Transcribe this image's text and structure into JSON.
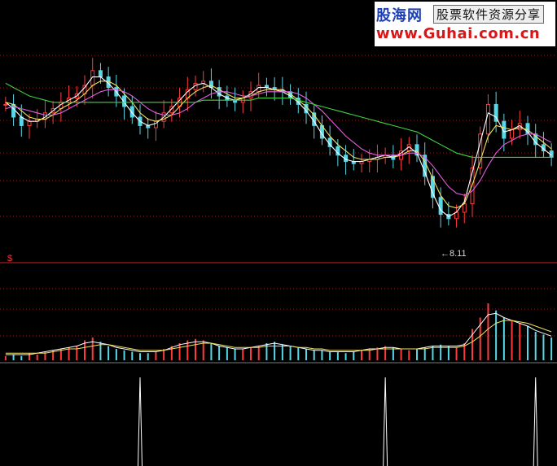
{
  "watermark": {
    "brand": "股海网",
    "tagline": "股票软件资源分享",
    "url": "www.Guhai.com.cn"
  },
  "price_label": "8.11",
  "marker": "$",
  "colors": {
    "background": "#000000",
    "up": "#ff3c3c",
    "down": "#5ad7e6",
    "ma_fast": "#ffffff",
    "ma_mid": "#f0e060",
    "ma_slow": "#e060e0",
    "ma_long": "#3fd43f",
    "grid": "#9b1a1a",
    "separator": "#d02020",
    "signal": "#ffffff"
  },
  "chart_data": [
    {
      "type": "candlestick",
      "title": "",
      "annotation": {
        "label": "8.11",
        "type": "low"
      },
      "series": [
        {
          "kind": "close",
          "values": [
            10.9,
            10.6,
            10.4,
            10.5,
            10.55,
            10.7,
            10.8,
            10.95,
            11.05,
            11.15,
            11.35,
            11.7,
            11.55,
            11.3,
            11.1,
            10.85,
            10.6,
            10.4,
            10.35,
            10.5,
            10.7,
            10.85,
            11.05,
            11.25,
            11.4,
            11.45,
            11.3,
            11.1,
            11.0,
            10.95,
            11.05,
            11.2,
            11.35,
            11.3,
            11.25,
            11.2,
            11.05,
            10.9,
            10.7,
            10.4,
            10.1,
            9.9,
            9.7,
            9.55,
            9.5,
            9.55,
            9.6,
            9.65,
            9.7,
            9.6,
            9.8,
            9.95,
            9.7,
            9.2,
            8.7,
            8.3,
            8.2,
            8.35,
            8.55,
            9.4,
            10.2,
            10.9,
            10.5,
            10.1,
            10.3,
            10.45,
            10.2,
            9.95,
            9.8,
            9.65
          ]
        },
        {
          "kind": "ma_fast",
          "values": [
            10.95,
            10.8,
            10.6,
            10.5,
            10.5,
            10.6,
            10.75,
            10.9,
            11.0,
            11.1,
            11.3,
            11.55,
            11.55,
            11.4,
            11.2,
            10.95,
            10.7,
            10.5,
            10.4,
            10.45,
            10.6,
            10.8,
            11.0,
            11.2,
            11.35,
            11.4,
            11.3,
            11.15,
            11.05,
            11.0,
            11.05,
            11.15,
            11.3,
            11.3,
            11.25,
            11.2,
            11.1,
            10.95,
            10.75,
            10.5,
            10.2,
            9.95,
            9.75,
            9.6,
            9.55,
            9.55,
            9.6,
            9.65,
            9.7,
            9.65,
            9.75,
            9.9,
            9.75,
            9.3,
            8.8,
            8.4,
            8.25,
            8.35,
            8.6,
            9.3,
            10.0,
            10.7,
            10.6,
            10.25,
            10.3,
            10.4,
            10.25,
            10.0,
            9.85,
            9.7
          ]
        },
        {
          "kind": "ma_mid",
          "values": [
            10.95,
            10.9,
            10.75,
            10.6,
            10.55,
            10.55,
            10.65,
            10.8,
            10.9,
            11.0,
            11.15,
            11.35,
            11.45,
            11.45,
            11.35,
            11.15,
            10.95,
            10.7,
            10.55,
            10.5,
            10.55,
            10.65,
            10.85,
            11.05,
            11.2,
            11.3,
            11.35,
            11.25,
            11.15,
            11.05,
            11.05,
            11.1,
            11.2,
            11.25,
            11.25,
            11.25,
            11.15,
            11.0,
            10.85,
            10.65,
            10.4,
            10.15,
            9.95,
            9.8,
            9.65,
            9.6,
            9.6,
            9.6,
            9.65,
            9.65,
            9.7,
            9.8,
            9.8,
            9.55,
            9.15,
            8.75,
            8.5,
            8.45,
            8.55,
            9.0,
            9.55,
            10.15,
            10.4,
            10.35,
            10.3,
            10.35,
            10.3,
            10.15,
            10.0,
            9.85
          ]
        },
        {
          "kind": "ma_slow",
          "values": [
            10.8,
            10.85,
            10.8,
            10.75,
            10.7,
            10.65,
            10.65,
            10.7,
            10.8,
            10.9,
            11.0,
            11.1,
            11.2,
            11.25,
            11.25,
            11.2,
            11.1,
            10.95,
            10.8,
            10.7,
            10.65,
            10.65,
            10.7,
            10.8,
            10.95,
            11.05,
            11.15,
            11.2,
            11.2,
            11.15,
            11.1,
            11.1,
            11.15,
            11.2,
            11.2,
            11.2,
            11.2,
            11.15,
            11.05,
            10.9,
            10.75,
            10.55,
            10.35,
            10.15,
            10.0,
            9.85,
            9.75,
            9.7,
            9.7,
            9.7,
            9.7,
            9.75,
            9.75,
            9.65,
            9.45,
            9.2,
            8.95,
            8.8,
            8.75,
            8.85,
            9.1,
            9.45,
            9.75,
            9.95,
            10.05,
            10.15,
            10.2,
            10.2,
            10.1,
            10.0
          ]
        },
        {
          "kind": "ma_long",
          "values": [
            11.4,
            11.3,
            11.2,
            11.1,
            11.05,
            11.0,
            10.95,
            10.95,
            10.95,
            10.95,
            10.95,
            10.95,
            10.95,
            10.95,
            10.95,
            10.95,
            10.95,
            10.95,
            10.95,
            10.95,
            10.95,
            10.95,
            10.95,
            10.95,
            10.95,
            11.0,
            11.0,
            11.0,
            11.0,
            11.0,
            11.0,
            11.0,
            11.05,
            11.05,
            11.05,
            11.05,
            11.05,
            11.0,
            10.95,
            10.9,
            10.85,
            10.8,
            10.75,
            10.7,
            10.65,
            10.6,
            10.55,
            10.5,
            10.45,
            10.4,
            10.35,
            10.3,
            10.25,
            10.15,
            10.05,
            9.95,
            9.85,
            9.75,
            9.7,
            9.65,
            9.65,
            9.65,
            9.65,
            9.65,
            9.65,
            9.65,
            9.65,
            9.65,
            9.65,
            9.65
          ]
        }
      ]
    },
    {
      "type": "bar",
      "title": "",
      "values": [
        3,
        4,
        3,
        5,
        4,
        6,
        7,
        8,
        9,
        10,
        14,
        16,
        13,
        10,
        8,
        7,
        6,
        5,
        5,
        6,
        8,
        10,
        12,
        14,
        15,
        14,
        12,
        10,
        9,
        8,
        8,
        9,
        10,
        12,
        13,
        11,
        10,
        9,
        8,
        7,
        7,
        6,
        6,
        5,
        6,
        7,
        8,
        9,
        10,
        9,
        8,
        7,
        8,
        9,
        10,
        11,
        10,
        9,
        12,
        22,
        30,
        40,
        35,
        30,
        28,
        26,
        24,
        20,
        18,
        16
      ],
      "ma_fast": [
        4,
        4,
        4,
        4,
        5,
        6,
        7,
        8,
        9,
        10,
        12,
        13,
        12,
        11,
        9,
        8,
        7,
        6,
        6,
        6,
        7,
        9,
        11,
        12,
        13,
        13,
        12,
        10,
        9,
        8,
        8,
        9,
        10,
        11,
        12,
        11,
        10,
        9,
        8,
        7,
        7,
        6,
        6,
        6,
        6,
        7,
        8,
        8,
        9,
        9,
        8,
        8,
        8,
        9,
        10,
        10,
        10,
        10,
        11,
        18,
        25,
        32,
        33,
        30,
        28,
        26,
        24,
        21,
        19,
        17
      ],
      "ma_slow": [
        5,
        5,
        5,
        5,
        5,
        5,
        6,
        7,
        8,
        8,
        9,
        10,
        11,
        11,
        10,
        9,
        8,
        7,
        7,
        7,
        7,
        8,
        9,
        10,
        11,
        12,
        12,
        11,
        10,
        9,
        9,
        9,
        9,
        10,
        10,
        10,
        10,
        9,
        9,
        8,
        8,
        7,
        7,
        7,
        7,
        7,
        7,
        8,
        8,
        8,
        8,
        8,
        8,
        8,
        9,
        9,
        9,
        9,
        10,
        13,
        17,
        22,
        26,
        28,
        28,
        27,
        26,
        24,
        22,
        20
      ]
    },
    {
      "type": "bar",
      "title": "",
      "values": [
        0,
        0,
        0,
        0,
        0,
        0,
        0,
        0,
        0,
        0,
        0,
        0,
        0,
        0,
        0,
        0,
        0,
        0,
        0,
        0,
        0,
        0,
        0,
        0,
        0,
        0,
        0,
        0,
        0,
        0,
        0,
        0,
        0,
        0,
        0,
        0,
        0,
        0,
        0,
        0,
        0,
        0,
        0,
        0,
        0,
        0,
        0,
        0,
        0,
        0,
        0,
        0,
        0,
        0,
        0,
        0,
        0,
        0,
        0,
        0,
        0,
        0,
        0,
        0,
        0,
        0,
        0,
        0,
        0,
        0
      ],
      "signals": [
        17,
        48,
        67
      ]
    }
  ]
}
